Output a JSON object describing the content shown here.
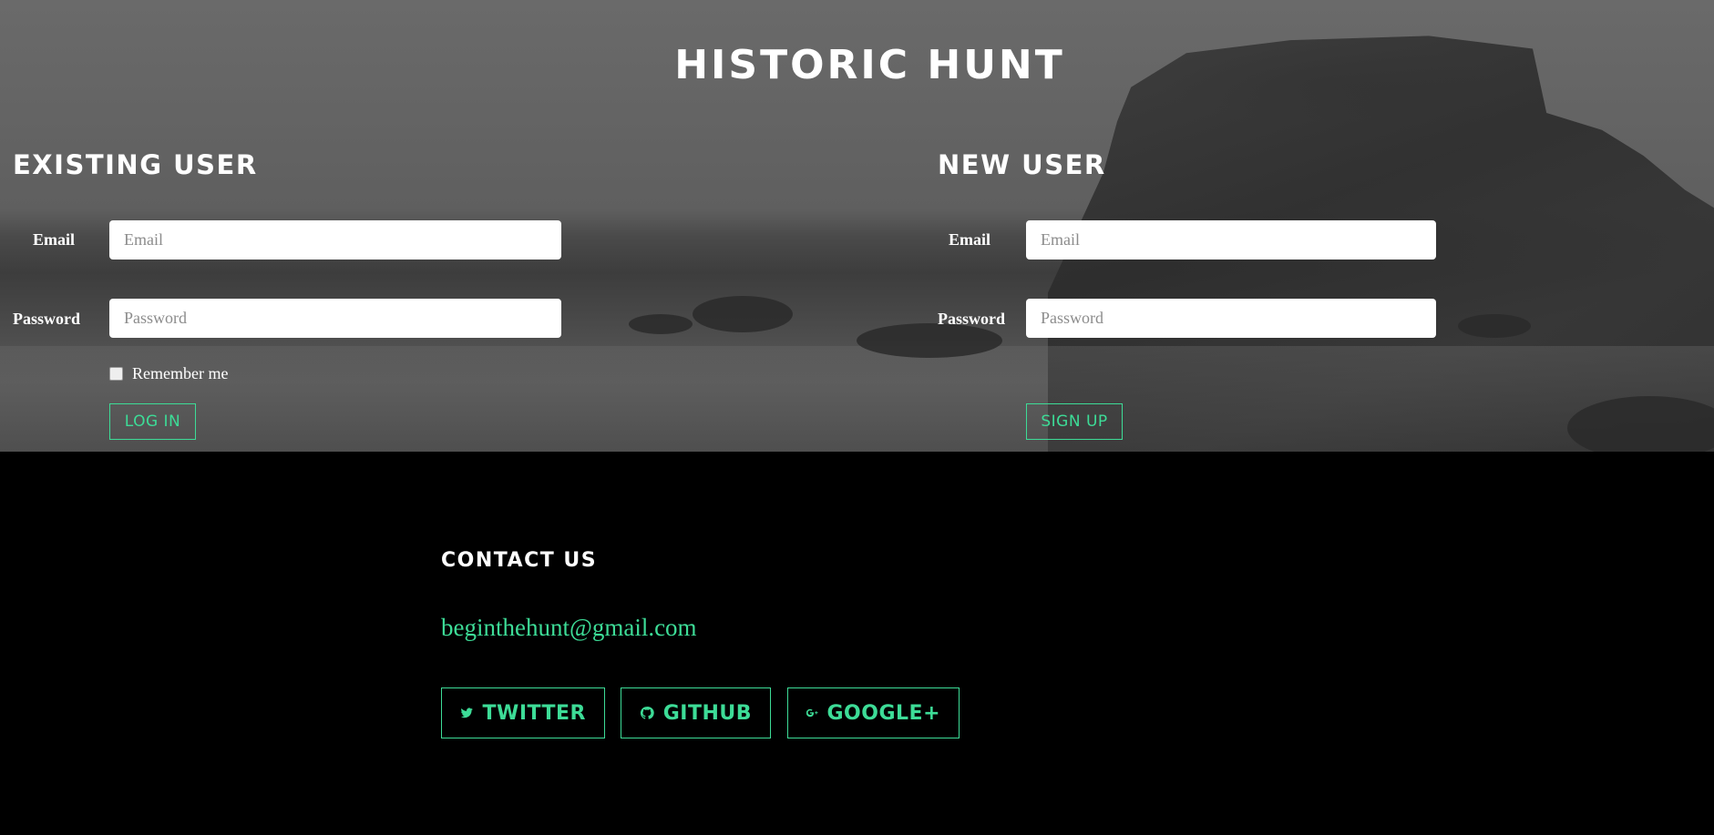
{
  "app": {
    "title": "HISTORIC HUNT"
  },
  "existing_user": {
    "heading": "EXISTING USER",
    "email_label": "Email",
    "email_placeholder": "Email",
    "password_label": "Password",
    "password_placeholder": "Password",
    "remember_label": "Remember me",
    "login_label": "LOG IN"
  },
  "new_user": {
    "heading": "NEW USER",
    "email_label": "Email",
    "email_placeholder": "Email",
    "password_label": "Password",
    "password_placeholder": "Password",
    "signup_label": "SIGN UP"
  },
  "footer": {
    "contact_heading": "CONTACT US",
    "email": "beginthehunt@gmail.com",
    "social": [
      {
        "icon": "twitter-icon",
        "label": "TWITTER"
      },
      {
        "icon": "github-icon",
        "label": "GITHUB"
      },
      {
        "icon": "google-plus-icon",
        "label": "GOOGLE+"
      }
    ]
  },
  "colors": {
    "accent": "#3ddc97",
    "footer_bg": "#000000",
    "text": "#ffffff"
  }
}
